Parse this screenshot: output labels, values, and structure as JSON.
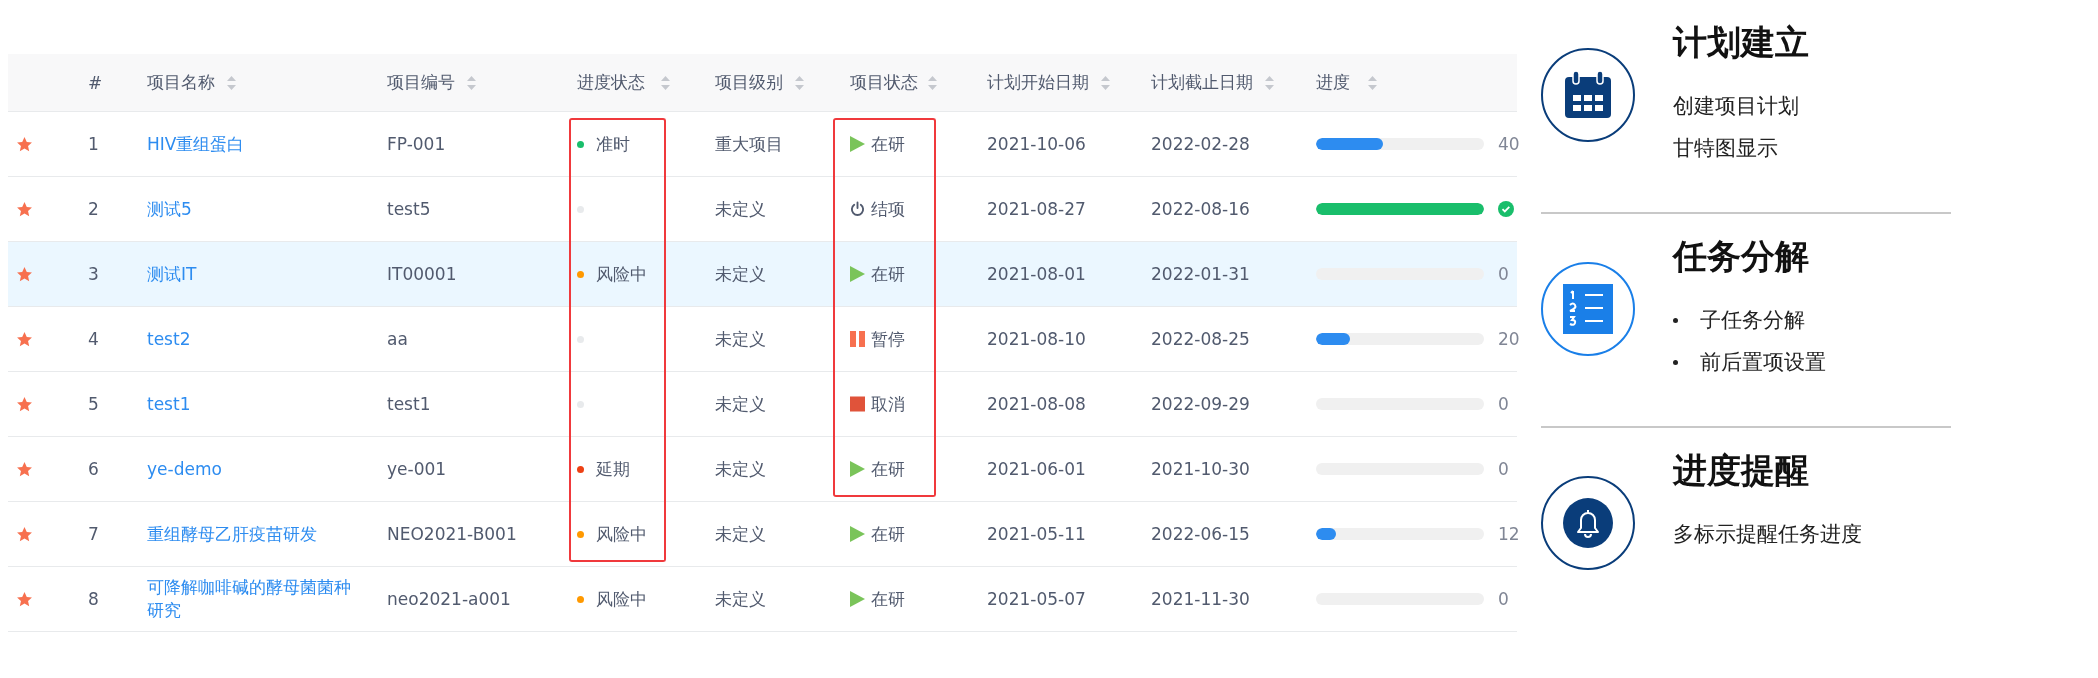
{
  "table": {
    "columns": [
      "#",
      "项目名称",
      "项目编号",
      "进度状态",
      "项目级别",
      "项目状态",
      "计划开始日期",
      "计划截止日期",
      "进度"
    ],
    "rows": [
      {
        "starred": true,
        "selected": false,
        "index": "1",
        "name": "HIV重组蛋白",
        "code": "FP-001",
        "progress_status": {
          "label": "准时",
          "color": "#19be6b",
          "boxed": true
        },
        "level_text": "重大项目",
        "status": {
          "kind": "running",
          "label": "在研",
          "boxed": true
        },
        "start": "2021-10-06",
        "end": "2022-02-28",
        "progress": {
          "level": 0.4,
          "done": false,
          "reading": "40"
        }
      },
      {
        "starred": true,
        "selected": false,
        "index": "2",
        "name": "测试5",
        "code": "test5",
        "progress_status": {
          "color": "#e8eaec",
          "boxed": true
        },
        "level_text": "未定义",
        "status": {
          "kind": "closed",
          "label": "结项",
          "boxed": true
        },
        "start": "2021-08-27",
        "end": "2022-08-16",
        "progress": {
          "level": 1,
          "done": true
        }
      },
      {
        "starred": true,
        "selected": true,
        "index": "3",
        "name": "测试IT",
        "code": "IT00001",
        "progress_status": {
          "label": "风险中",
          "color": "#ff9900",
          "boxed": true
        },
        "level_text": "未定义",
        "status": {
          "kind": "running",
          "label": "在研",
          "boxed": true
        },
        "start": "2021-08-01",
        "end": "2022-01-31",
        "progress": {
          "level": 0,
          "done": false,
          "reading": "0"
        }
      },
      {
        "starred": true,
        "selected": false,
        "index": "4",
        "name": "test2",
        "code": "aa",
        "progress_status": {
          "color": "#e8eaec",
          "boxed": true
        },
        "level_text": "未定义",
        "status": {
          "kind": "paused",
          "label": "暂停",
          "boxed": true
        },
        "start": "2021-08-10",
        "end": "2022-08-25",
        "progress": {
          "level": 0.2,
          "done": false,
          "reading": "20"
        }
      },
      {
        "starred": true,
        "selected": false,
        "index": "5",
        "name": "test1",
        "code": "test1",
        "progress_status": {
          "color": "#e8eaec",
          "boxed": true
        },
        "level_text": "未定义",
        "status": {
          "kind": "cancelled",
          "label": "取消",
          "boxed": true
        },
        "start": "2021-08-08",
        "end": "2022-09-29",
        "progress": {
          "level": 0,
          "done": false,
          "reading": "0"
        }
      },
      {
        "starred": true,
        "selected": false,
        "index": "6",
        "name": "ye-demo",
        "code": "ye-001",
        "progress_status": {
          "label": "延期",
          "color": "#ed4014",
          "boxed": true
        },
        "level_text": "未定义",
        "status": {
          "kind": "running",
          "label": "在研",
          "boxed": true
        },
        "start": "2021-06-01",
        "end": "2021-10-30",
        "progress": {
          "level": 0,
          "done": false,
          "reading": "0"
        }
      },
      {
        "starred": true,
        "selected": false,
        "index": "7",
        "name": "重组酵母乙肝疫苗研发",
        "code": "NEO2021-B001",
        "progress_status": {
          "label": "风险中",
          "color": "#ff9900",
          "boxed": true
        },
        "level_text": "未定义",
        "status": {
          "kind": "running",
          "label": "在研",
          "boxed": false
        },
        "start": "2021-05-11",
        "end": "2022-06-15",
        "progress": {
          "level": 0.12,
          "done": false,
          "reading": "12"
        }
      },
      {
        "starred": true,
        "selected": false,
        "index": "8",
        "name": "可降解咖啡碱的酵母菌菌种研究",
        "code": "neo2021-a001",
        "progress_status": {
          "label": "风险中",
          "color": "#ff9900",
          "boxed": false
        },
        "level_text": "未定义",
        "status": {
          "kind": "running",
          "label": "在研",
          "boxed": false
        },
        "start": "2021-05-07",
        "end": "2021-11-30",
        "progress": {
          "level": 0,
          "done": false,
          "reading": "0"
        }
      }
    ]
  },
  "features": [
    {
      "kind": "calendar",
      "title": "计划建立",
      "lines": [
        "创建项目计划",
        "甘特图显示"
      ],
      "bulleted": false
    },
    {
      "kind": "list",
      "title": "任务分解",
      "lines": [
        "子任务分解",
        "前后置项设置"
      ],
      "bulleted": true
    },
    {
      "kind": "bell",
      "title": "进度提醒",
      "lines": [
        "多标示提醒任务进度"
      ],
      "bulleted": false
    }
  ]
}
